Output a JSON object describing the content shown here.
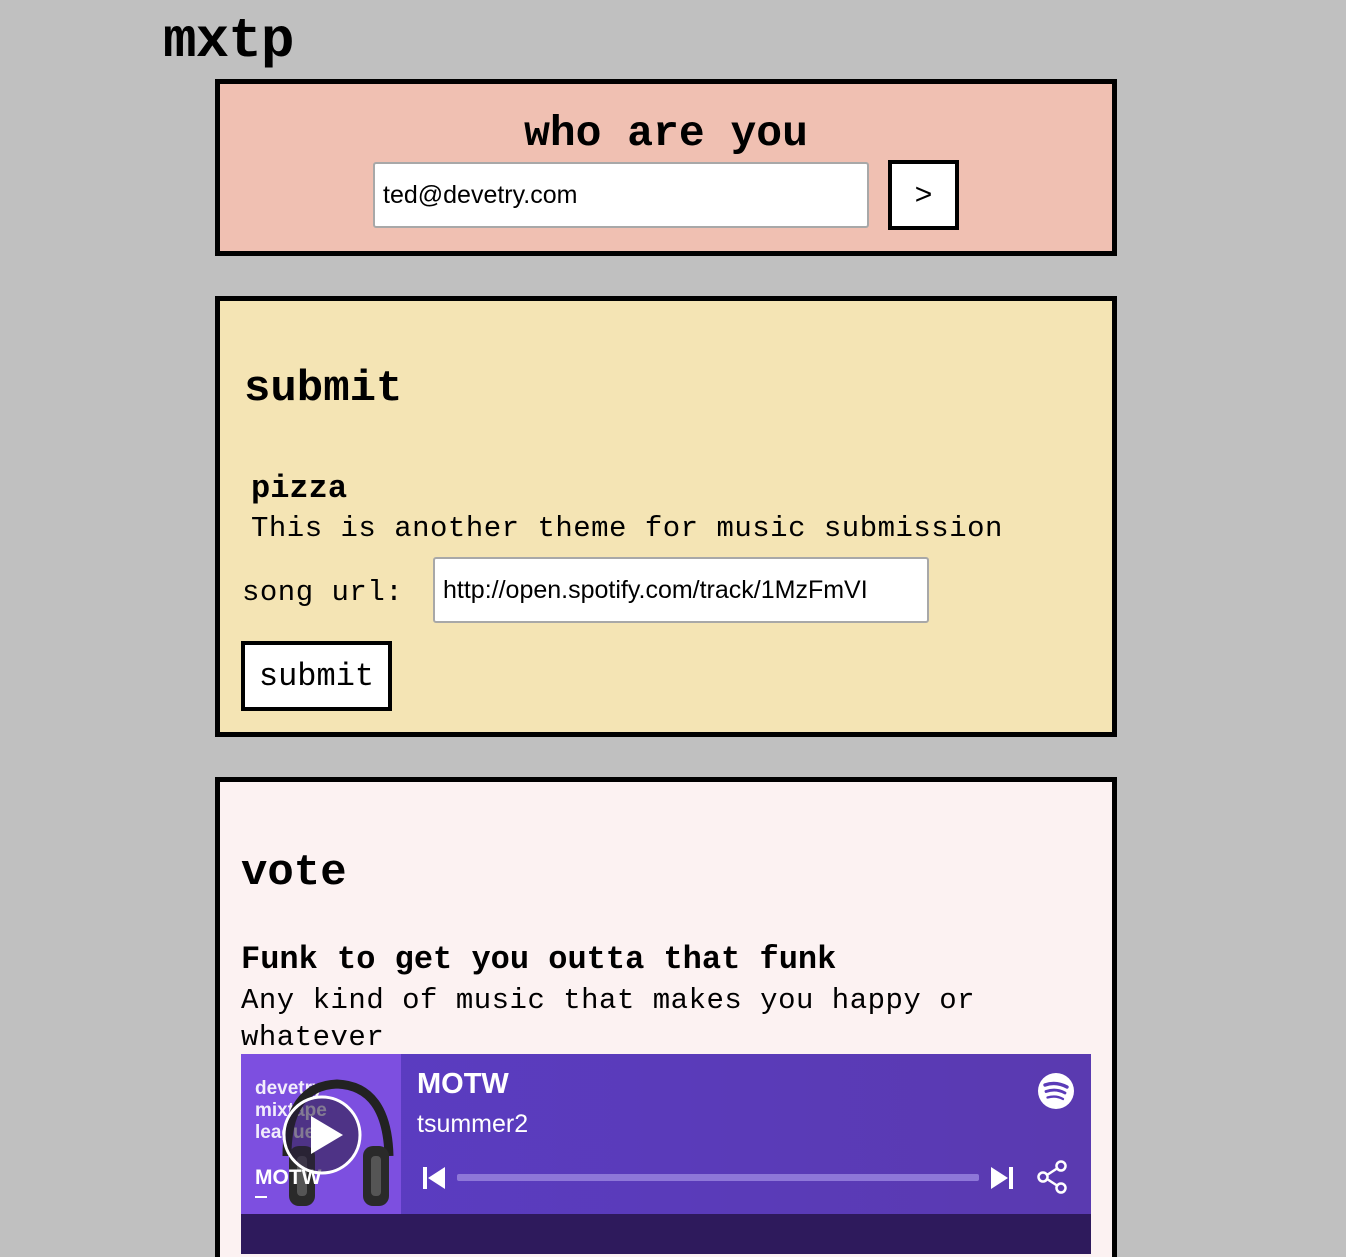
{
  "app": {
    "logo": "mxtp"
  },
  "who": {
    "title": "who are you",
    "email_value": "ted@devetry.com",
    "go_label": ">"
  },
  "submit": {
    "title": "submit",
    "theme_name": "pizza",
    "theme_desc": "This is another theme for music submission",
    "url_label": "song url:",
    "url_value": "http://open.spotify.com/track/1MzFmVI",
    "button_label": "submit"
  },
  "vote": {
    "title": "vote",
    "theme_name": "Funk to get you outta that funk",
    "theme_desc": "Any kind of music that makes you happy or whatever",
    "player": {
      "cover_text": "devetry mixtape league",
      "cover_sub": "MOTW",
      "title": "MOTW",
      "artist": "tsummer2",
      "progress": 0,
      "icons": [
        "play-icon",
        "spotify-icon",
        "previous-icon",
        "next-icon",
        "share-icon"
      ]
    }
  },
  "colors": {
    "background": "#c0c0c0",
    "who_panel": "#f0c0b2",
    "submit_panel": "#f4e4b4",
    "vote_panel": "#fcf2f2",
    "player": "#5a3bb8"
  }
}
